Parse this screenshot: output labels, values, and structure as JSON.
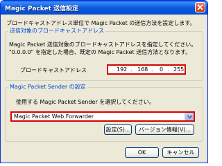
{
  "window": {
    "title": "Magic Packet 送信設定",
    "close_icon": "close-icon"
  },
  "description": "ブロードキャストアドレス単位で Magic Packet の送信方法を設定します。",
  "broadcast_group": {
    "legend": "送信対象のブロードキャストアドレス",
    "line1": "Magic Packet 送信対象のブロードキャストアドレスを指定してください。",
    "line2": "\"0.0.0.0\" を指定した場合、既定の Magic Packet 送信方法となります。",
    "label": "ブロードキャストアドレス",
    "ip": [
      "192",
      "168",
      "0",
      "255"
    ]
  },
  "sender_group": {
    "legend": "Magic Packet Sender の設定",
    "instruction": "使用する Magic Packet Sender を選択してください。",
    "selected": "Magic Packet Web Forwarder",
    "settings_label": "設定(S)...",
    "version_label": "バージョン情報(V)..."
  },
  "footer": {
    "ok_label": "OK",
    "cancel_label": "キャンセル"
  },
  "colors": {
    "title_bar": "#0a5fe3",
    "group_legend": "#0046d5",
    "highlight": "#d90000",
    "dialog_bg": "#ece9d8"
  }
}
